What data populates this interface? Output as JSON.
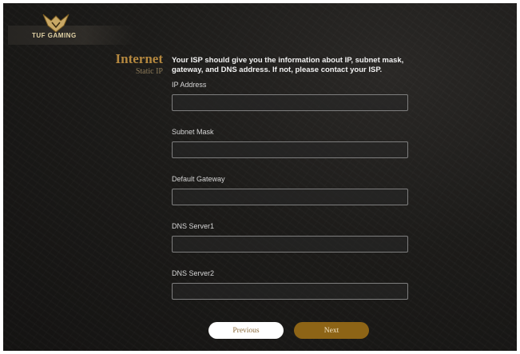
{
  "logo": {
    "text": "TUF GAMING",
    "emblem_icon": "tuf-emblem-icon"
  },
  "heading": {
    "title": "Internet",
    "subtitle": "Static IP"
  },
  "description": "Your ISP should give you the information about IP, subnet mask, gateway, and DNS address. If not, please contact your ISP.",
  "fields": [
    {
      "label": "IP Address",
      "value": "",
      "placeholder": ""
    },
    {
      "label": "Subnet Mask",
      "value": "",
      "placeholder": ""
    },
    {
      "label": "Default Gateway",
      "value": "",
      "placeholder": ""
    },
    {
      "label": "DNS Server1",
      "value": "",
      "placeholder": ""
    },
    {
      "label": "DNS Server2",
      "value": "",
      "placeholder": ""
    }
  ],
  "buttons": {
    "previous": "Previous",
    "next": "Next"
  },
  "colors": {
    "accent": "#b5883f",
    "next_button": "#8d6416",
    "previous_button": "#ffffff"
  }
}
